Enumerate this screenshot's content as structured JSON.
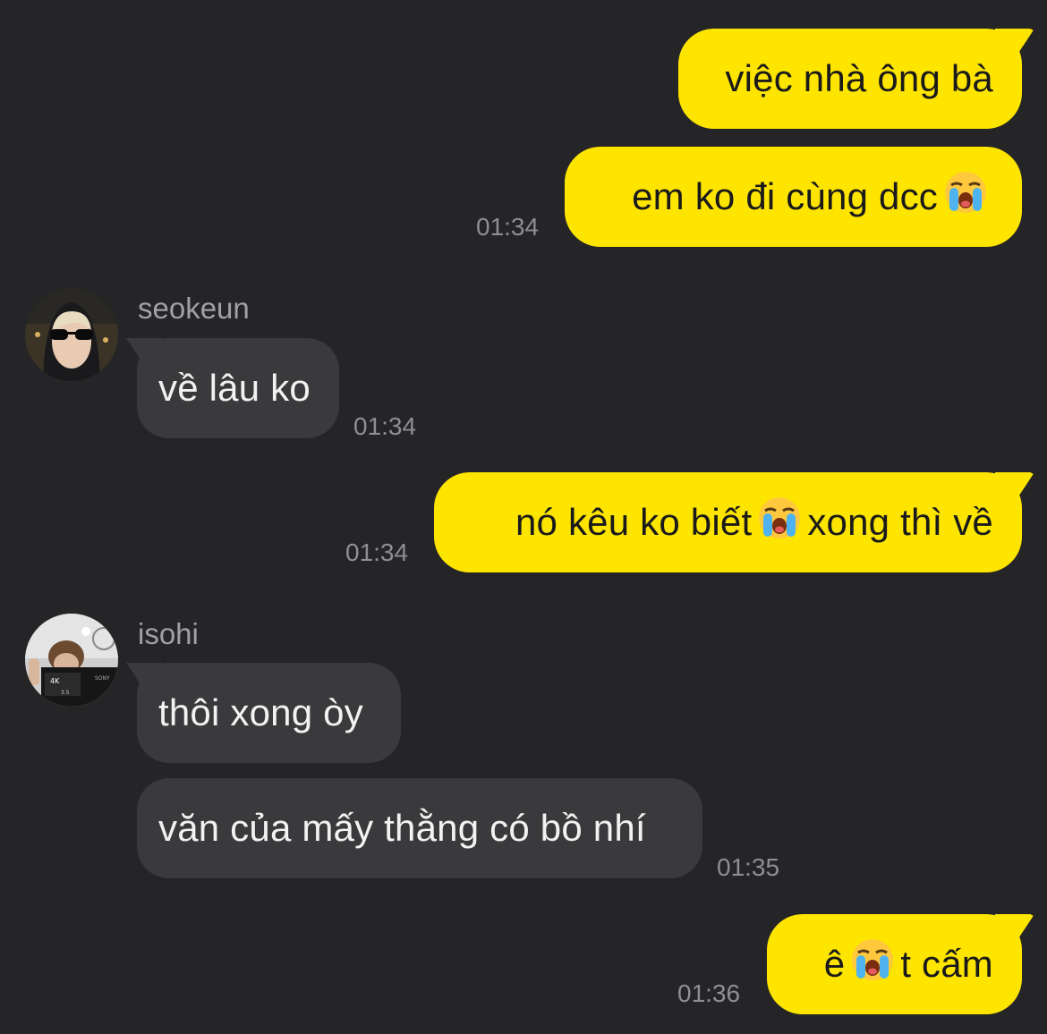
{
  "colors": {
    "background": "#252527",
    "my_bubble": "#FEE500",
    "their_bubble": "#3a3a3c",
    "timestamp": "#8e8e93"
  },
  "messages": [
    {
      "text": "việc nhà ông bà"
    },
    {
      "text_a": "em ko đi cùng dcc",
      "emoji": "loudly-crying-face",
      "time": "01:34"
    },
    {
      "sender": "seokeun",
      "text": "về lâu ko",
      "time": "01:34"
    },
    {
      "text_a": "nó kêu ko biết",
      "emoji": "loudly-crying-face",
      "text_b": "xong thì về",
      "time": "01:34"
    },
    {
      "sender": "isohi",
      "text": "thôi xong òy"
    },
    {
      "text": "văn của mấy thằng có bồ nhí",
      "time": "01:35"
    },
    {
      "text_a": "ê",
      "emoji": "loudly-crying-face",
      "text_b": "t cấm",
      "time": "01:36"
    }
  ]
}
